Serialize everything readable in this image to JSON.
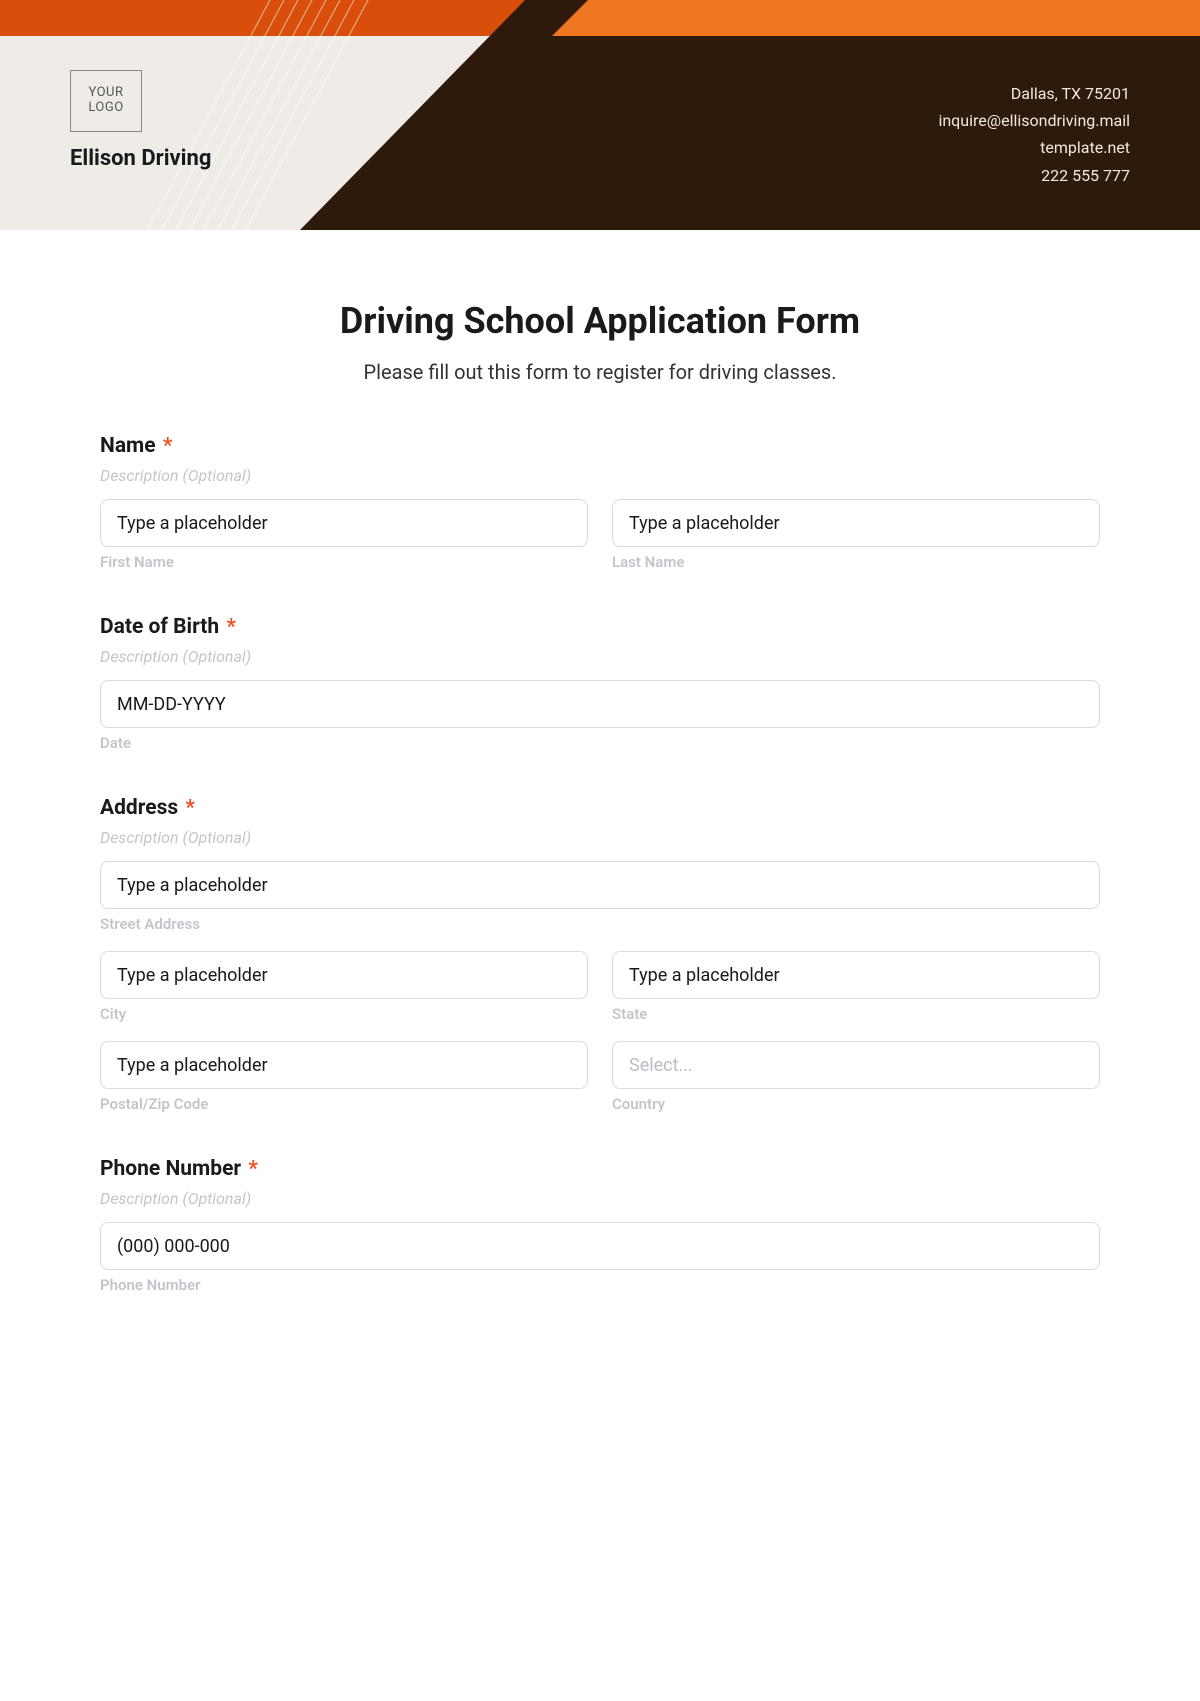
{
  "header": {
    "logo_text": "YOUR\nLOGO",
    "company": "Ellison Driving",
    "contact": {
      "line1": "Dallas, TX 75201",
      "line2": "inquire@ellisondriving.mail",
      "line3": "template.net",
      "line4": "222 555 777"
    }
  },
  "form": {
    "title": "Driving School Application Form",
    "subtitle": "Please fill out this form to register for driving classes.",
    "required_mark": "*",
    "desc_placeholder": "Description (Optional)",
    "generic_placeholder": "Type a placeholder",
    "select_placeholder": "Select...",
    "sections": {
      "name": {
        "label": "Name",
        "first_sub": "First Name",
        "last_sub": "Last Name"
      },
      "dob": {
        "label": "Date of Birth",
        "placeholder": "MM-DD-YYYY",
        "sub": "Date"
      },
      "address": {
        "label": "Address",
        "street_sub": "Street Address",
        "city_sub": "City",
        "state_sub": "State",
        "postal_sub": "Postal/Zip Code",
        "country_sub": "Country"
      },
      "phone": {
        "label": "Phone Number",
        "placeholder": "(000) 000-000",
        "sub": "Phone Number"
      }
    }
  }
}
